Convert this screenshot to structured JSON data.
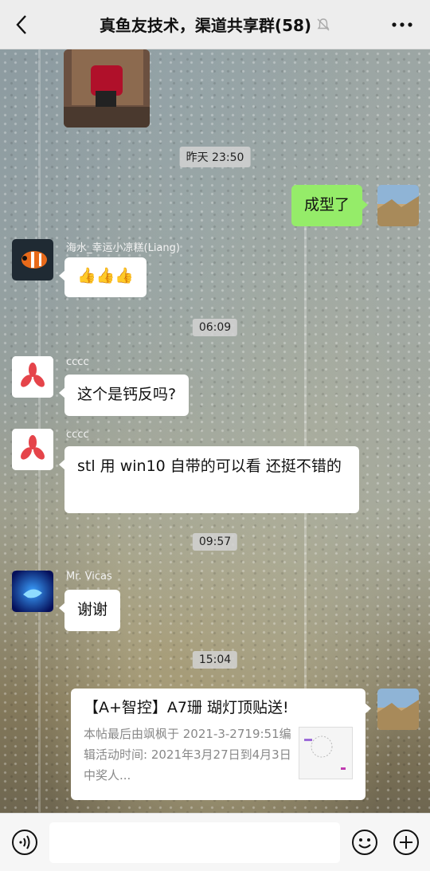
{
  "header": {
    "title": "真鱼友技术，渠道共享群(58)",
    "back_icon": "chevron-left-icon",
    "mute_icon": "bell-off-icon",
    "more_icon": "more-dots-icon"
  },
  "messages": {
    "t1": "昨天 23:50",
    "self_text": "成型了",
    "haishui_name": "海水_幸运小凉糕(Liang)",
    "haishui_text": "👍👍👍",
    "t2": "06:09",
    "cccc_name_1": "cccc",
    "cccc_text_1": "这个是钙反吗?",
    "cccc_name_2": "cccc",
    "cccc_text_2": "stl 用 win10 自带的可以看 还挺不错的",
    "t3": "09:57",
    "vicas_name": "Mr. Vicas",
    "vicas_text": "谢谢",
    "t4": "15:04",
    "card_title": "【A+智控】A7珊 瑚灯顶贴送!",
    "card_desc": "本帖最后由飒枫于 2021-3-2719:51编辑活动时间: 2021年3月27日到4月3日中奖人..."
  },
  "input": {
    "voice_icon": "voice-icon",
    "emoji_icon": "emoji-icon",
    "plus_icon": "plus-icon"
  }
}
